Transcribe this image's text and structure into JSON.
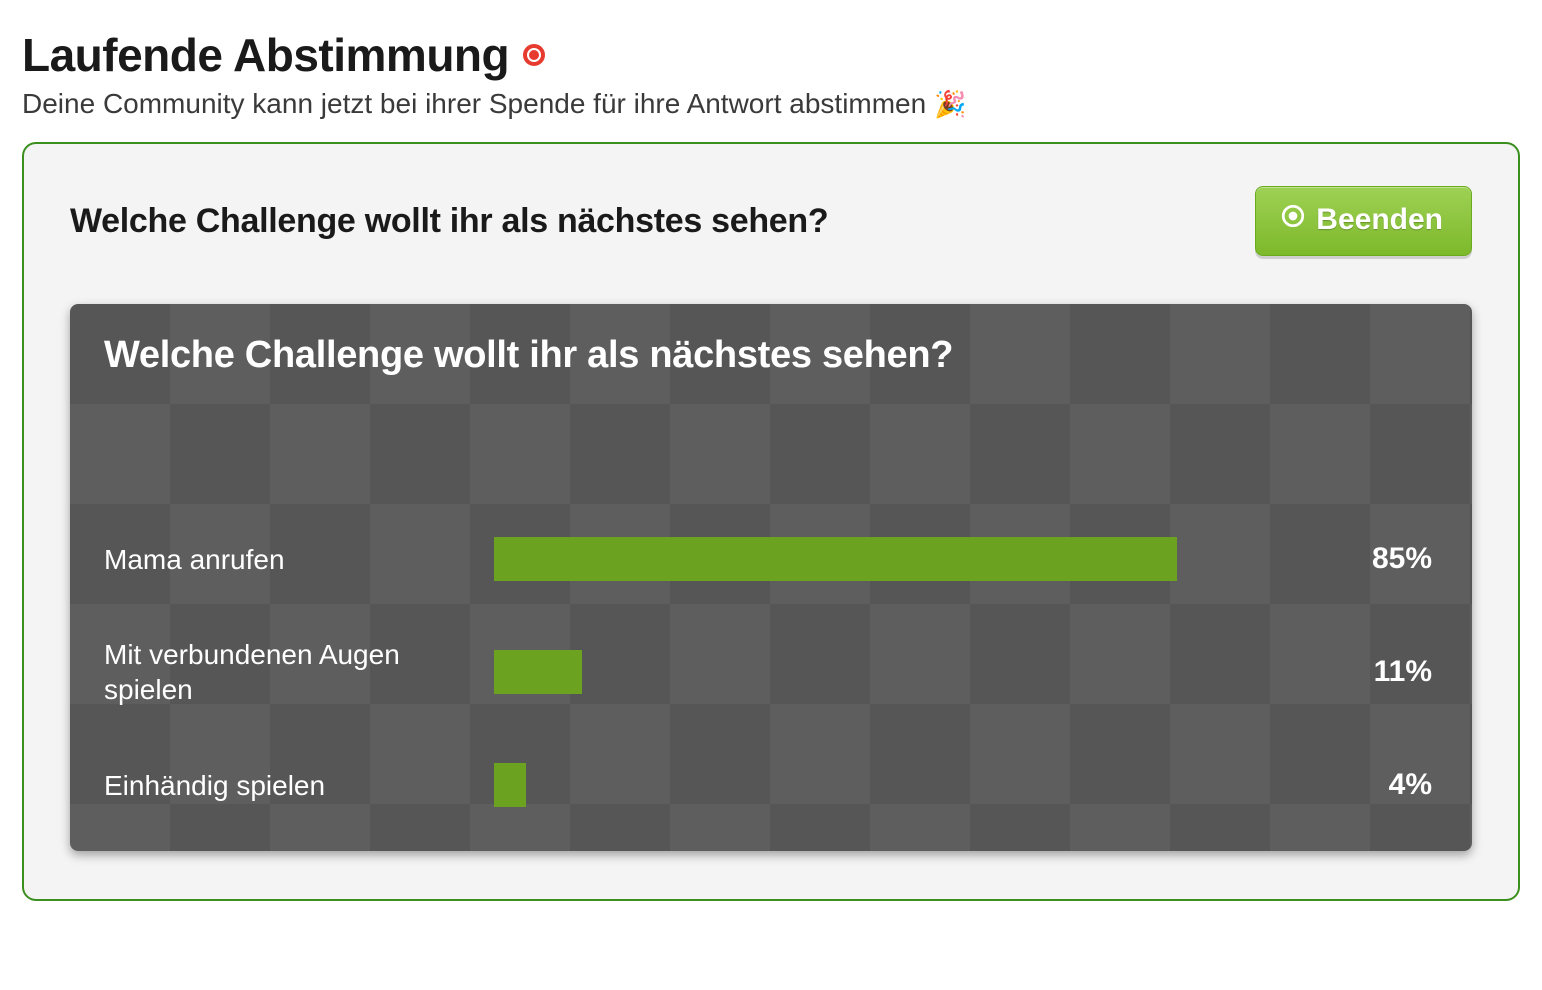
{
  "header": {
    "title": "Laufende Abstimmung",
    "subtitle": "Deine Community kann jetzt bei ihrer Spende für ihre Antwort abstimmen",
    "emoji": "🎉"
  },
  "panel": {
    "question": "Welche Challenge wollt ihr als nächstes sehen?",
    "end_button_label": "Beenden"
  },
  "result": {
    "question": "Welche Challenge wollt ihr als nächstes sehen?"
  },
  "chart_data": {
    "type": "bar",
    "title": "Welche Challenge wollt ihr als nächstes sehen?",
    "xlabel": "",
    "ylabel": "",
    "ylim": [
      0,
      100
    ],
    "categories": [
      "Mama anrufen",
      "Mit verbundenen Augen spielen",
      "Einhändig spielen"
    ],
    "values": [
      85,
      11,
      4
    ]
  },
  "colors": {
    "accent": "#8cc63f",
    "bar": "#6ba321",
    "live": "#e63b2e",
    "panel_border": "#3b8f1e"
  }
}
